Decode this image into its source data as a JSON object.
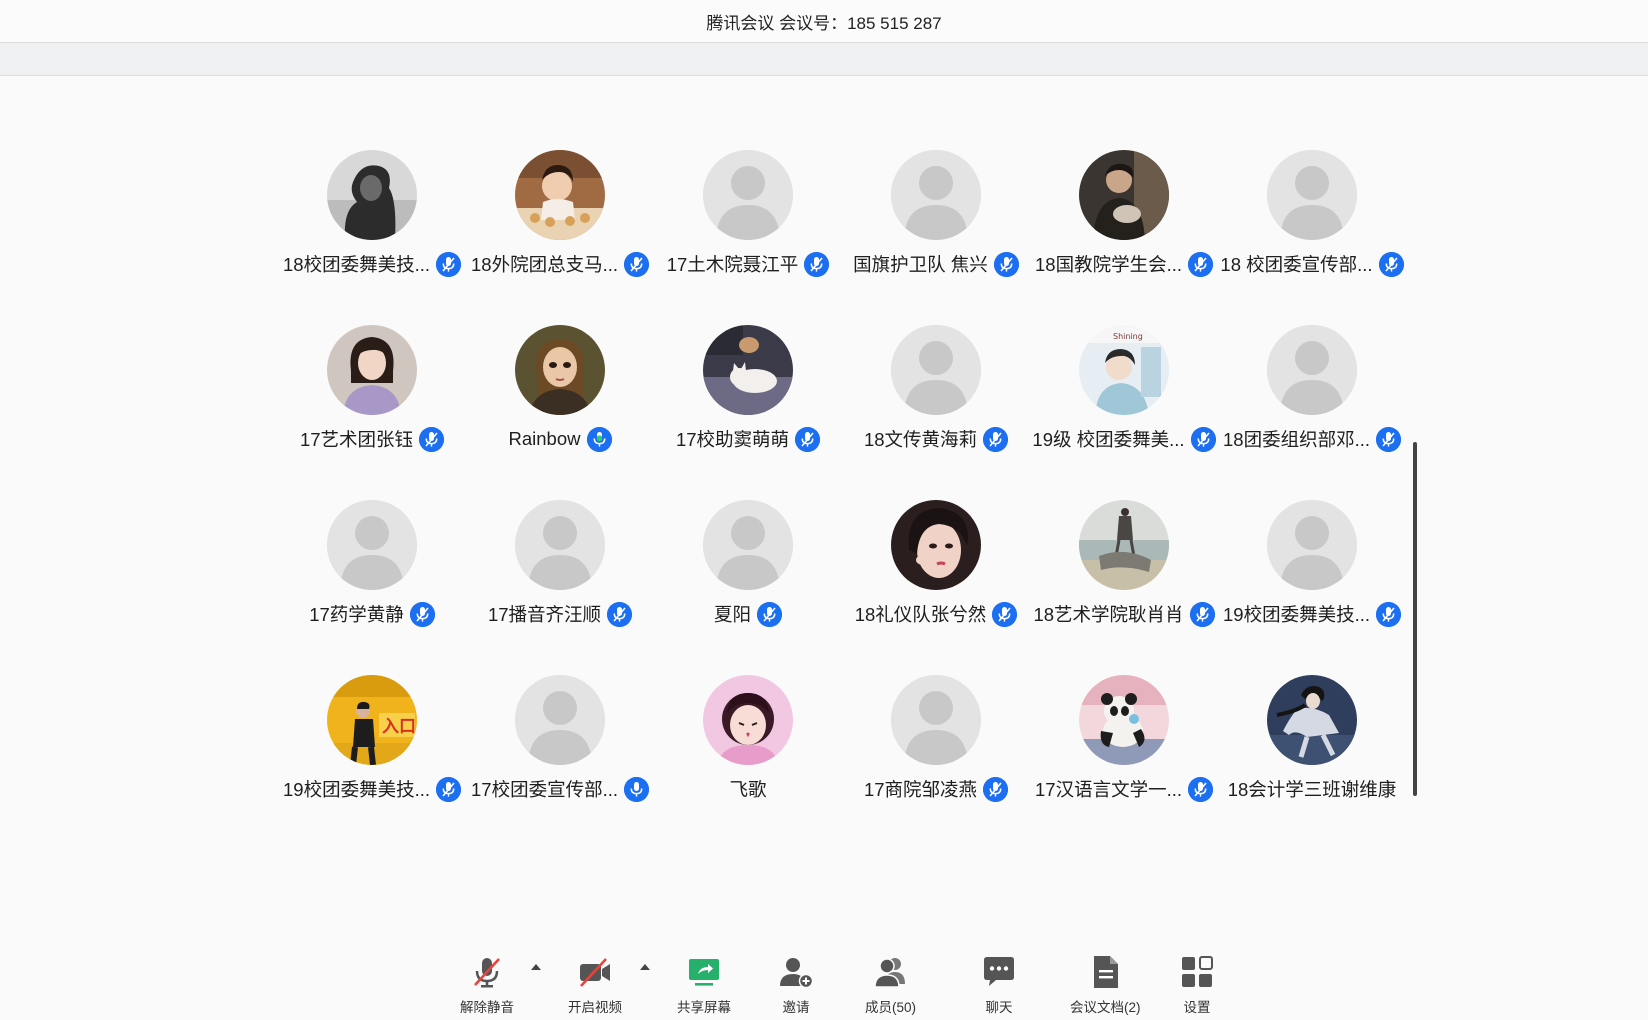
{
  "window": {
    "title": "腾讯会议 会议号：185 515 287"
  },
  "participants": [
    {
      "name": "18校团委舞美技...",
      "avatar": "photo-dark-hair",
      "mic": "muted"
    },
    {
      "name": "18外院团总支马...",
      "avatar": "photo-child",
      "mic": "muted"
    },
    {
      "name": "17土木院聂江平",
      "avatar": "default",
      "mic": "muted"
    },
    {
      "name": "国旗护卫队  焦兴",
      "avatar": "default",
      "mic": "muted"
    },
    {
      "name": "18国教院学生会...",
      "avatar": "photo-man-cat",
      "mic": "muted"
    },
    {
      "name": "18 校团委宣传部...",
      "avatar": "default",
      "mic": "muted"
    },
    {
      "name": "17艺术团张钰",
      "avatar": "photo-girl-bob",
      "mic": "muted"
    },
    {
      "name": "Rainbow",
      "avatar": "photo-painting",
      "mic": "active"
    },
    {
      "name": "17校助窦萌萌",
      "avatar": "photo-cat",
      "mic": "muted"
    },
    {
      "name": "18文传黄海莉",
      "avatar": "default",
      "mic": "muted"
    },
    {
      "name": "19级 校团委舞美...",
      "avatar": "photo-shining",
      "mic": "muted"
    },
    {
      "name": "18团委组织部邓...",
      "avatar": "default",
      "mic": "muted"
    },
    {
      "name": "17药学黄静",
      "avatar": "default",
      "mic": "muted"
    },
    {
      "name": "17播音齐汪顺",
      "avatar": "default",
      "mic": "muted"
    },
    {
      "name": "夏阳",
      "avatar": "default",
      "mic": "muted"
    },
    {
      "name": "18礼仪队张兮然",
      "avatar": "photo-girl-face",
      "mic": "muted"
    },
    {
      "name": "18艺术学院耿肖肖",
      "avatar": "photo-beach",
      "mic": "muted"
    },
    {
      "name": "19校团委舞美技...",
      "avatar": "default",
      "mic": "muted"
    },
    {
      "name": "19校团委舞美技...",
      "avatar": "photo-yellow-sign",
      "mic": "muted"
    },
    {
      "name": "17校团委宣传部...",
      "avatar": "default",
      "mic": "on"
    },
    {
      "name": "飞歌",
      "avatar": "photo-pink-girl",
      "mic": "none"
    },
    {
      "name": "17商院邹凌燕",
      "avatar": "default",
      "mic": "muted"
    },
    {
      "name": "17汉语言文学一...",
      "avatar": "photo-panda",
      "mic": "muted"
    },
    {
      "name": "18会计学三班谢维康",
      "avatar": "photo-anime",
      "mic": "none"
    }
  ],
  "toolbar": {
    "unmute": "解除静音",
    "start_video": "开启视频",
    "share_screen": "共享屏幕",
    "invite": "邀请",
    "members": "成员(50)",
    "chat": "聊天",
    "docs": "会议文档(2)",
    "settings": "设置"
  },
  "colors": {
    "mic_badge": "#1d6ff2",
    "mic_active": "#2ecc71",
    "share_icon": "#27b06b",
    "mute_slash": "#e8433b"
  }
}
